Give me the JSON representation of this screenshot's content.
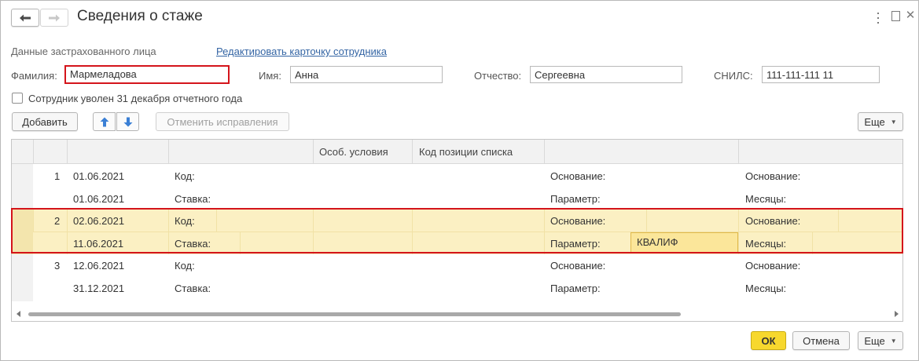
{
  "window": {
    "title": "Сведения о стаже"
  },
  "section": {
    "label": "Данные застрахованного лица",
    "edit_link": "Редактировать карточку сотрудника"
  },
  "fields": {
    "surname_label": "Фамилия:",
    "surname_value": "Мармеладова",
    "name_label": "Имя:",
    "name_value": "Анна",
    "patronymic_label": "Отчество:",
    "patronymic_value": "Сергеевна",
    "snils_label": "СНИЛС:",
    "snils_value": "111-111-111 11"
  },
  "checkbox": {
    "label": "Сотрудник уволен 31 декабря отчетного года",
    "checked": false
  },
  "toolbar": {
    "add_label": "Добавить",
    "cancel_corrections_label": "Отменить исправления",
    "more_label": "Еще"
  },
  "table": {
    "headers": {
      "special_conditions": "Особ. условия",
      "list_position_code": "Код позиции списка"
    },
    "rows": [
      {
        "num": "1",
        "date_from": "01.06.2021",
        "date_to": "01.06.2021",
        "code_label": "Код:",
        "rate_label": "Ставка:",
        "basis_label": "Основание:",
        "param_label": "Параметр:",
        "param_value": "",
        "basis2_label": "Основание:",
        "months_label": "Месяцы:"
      },
      {
        "num": "2",
        "date_from": "02.06.2021",
        "date_to": "11.06.2021",
        "code_label": "Код:",
        "rate_label": "Ставка:",
        "basis_label": "Основание:",
        "param_label": "Параметр:",
        "param_value": "КВАЛИФ",
        "basis2_label": "Основание:",
        "months_label": "Месяцы:"
      },
      {
        "num": "3",
        "date_from": "12.06.2021",
        "date_to": "31.12.2021",
        "code_label": "Код:",
        "rate_label": "Ставка:",
        "basis_label": "Основание:",
        "param_label": "Параметр:",
        "param_value": "",
        "basis2_label": "Основание:",
        "months_label": "Месяцы:"
      }
    ]
  },
  "footer": {
    "ok_label": "ОК",
    "cancel_label": "Отмена",
    "more_label": "Еще"
  },
  "colors": {
    "highlight_border": "#d4141b",
    "selected_row": "#fbf0c3",
    "active_cell": "#fbe69a",
    "ok_button": "#f7d82e",
    "link": "#3465a4",
    "arrow_icon": "#3a7fd5"
  }
}
